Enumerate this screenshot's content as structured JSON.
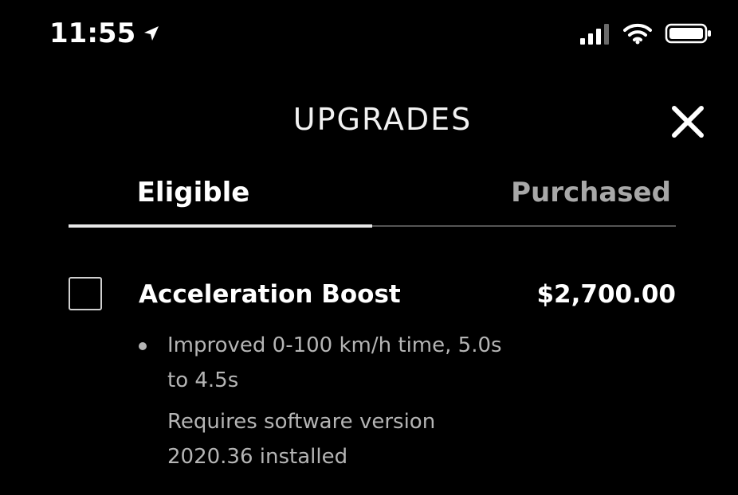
{
  "status_bar": {
    "time": "11:55",
    "icons": [
      "location-arrow-icon",
      "signal-bars-icon",
      "wifi-icon",
      "battery-icon"
    ]
  },
  "header": {
    "title": "UPGRADES",
    "close_icon": "close-icon"
  },
  "tabs": [
    {
      "label": "Eligible",
      "active": true
    },
    {
      "label": "Purchased",
      "active": false
    }
  ],
  "upgrade": {
    "checked": false,
    "name": "Acceleration Boost",
    "price": "$2,700.00",
    "features": [
      "Improved 0-100 km/h time, 5.0s to 4.5s"
    ],
    "requirement": "Requires software version 2020.36 installed"
  },
  "colors": {
    "background": "#000000",
    "text_primary": "#ffffff",
    "text_secondary": "#b5b5b5",
    "tab_inactive": "#a8a8a8"
  }
}
